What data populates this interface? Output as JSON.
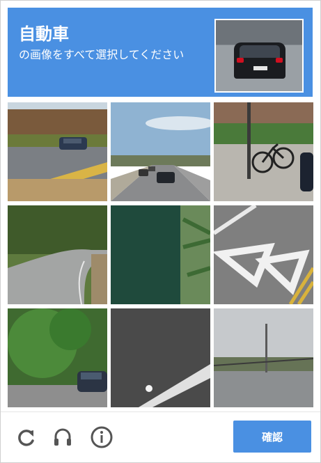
{
  "header": {
    "title": "自動車",
    "subtitle": "の画像をすべて選択してください"
  },
  "footer": {
    "verify_label": "確認"
  },
  "colors": {
    "accent": "#4a90e2",
    "icon": "#555555"
  },
  "icons": [
    "reload-icon",
    "audio-icon",
    "info-icon"
  ]
}
